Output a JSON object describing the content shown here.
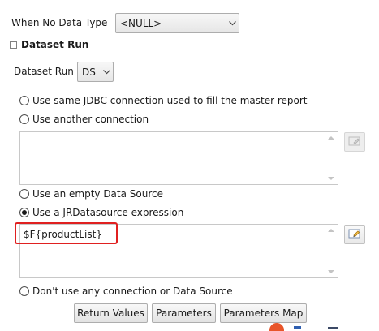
{
  "when_no_data": {
    "label": "When No Data Type",
    "value": "<NULL>"
  },
  "section": {
    "title": "Dataset Run"
  },
  "dataset_run": {
    "label": "Dataset Run",
    "value": "DS"
  },
  "options": {
    "same_jdbc": "Use same JDBC connection used to fill the master report",
    "another_connection": "Use another connection",
    "another_connection_value": "",
    "empty_datasource": "Use an empty Data Source",
    "jrdatasource_expression": "Use a JRDatasource expression",
    "jrdatasource_expression_value": "$F{productList}",
    "no_connection": "Don't use any connection or Data Source",
    "selected": "jrdatasource_expression"
  },
  "buttons": {
    "return_values": "Return Values",
    "parameters": "Parameters",
    "parameters_map": "Parameters Map"
  }
}
